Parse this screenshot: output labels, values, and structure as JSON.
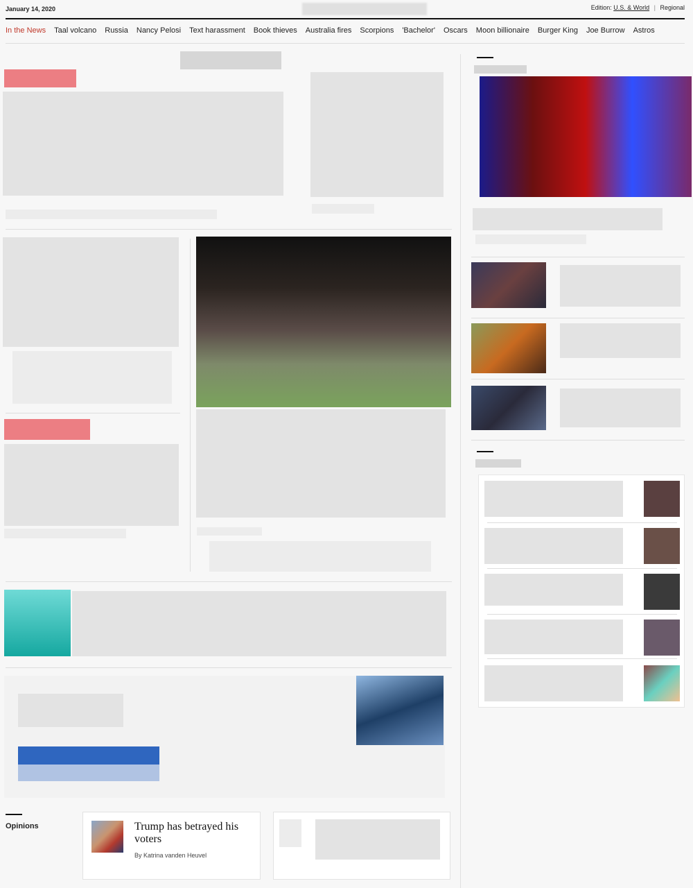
{
  "header": {
    "date": "January 14, 2020",
    "edition_label": "Edition:",
    "edition_active": "U.S. & World",
    "edition_separator": "|",
    "edition_other": "Regional"
  },
  "nav": {
    "items": [
      "In the News",
      "Taal volcano",
      "Russia",
      "Nancy Pelosi",
      "Text harassment",
      "Book thieves",
      "Australia fires",
      "Scorpions",
      "'Bachelor'",
      "Oscars",
      "Moon billionaire",
      "Burger King",
      "Joe Burrow",
      "Astros"
    ]
  },
  "opinions": {
    "label": "Opinions",
    "cards": [
      {
        "title": "Trump has betrayed his voters",
        "byline": "By Katrina vanden Heuvel"
      }
    ]
  },
  "colors": {
    "accent_red": "#c0392b",
    "tag_red": "#e8555c",
    "teal": "#5fd0cc",
    "blue": "#1f58b0"
  }
}
